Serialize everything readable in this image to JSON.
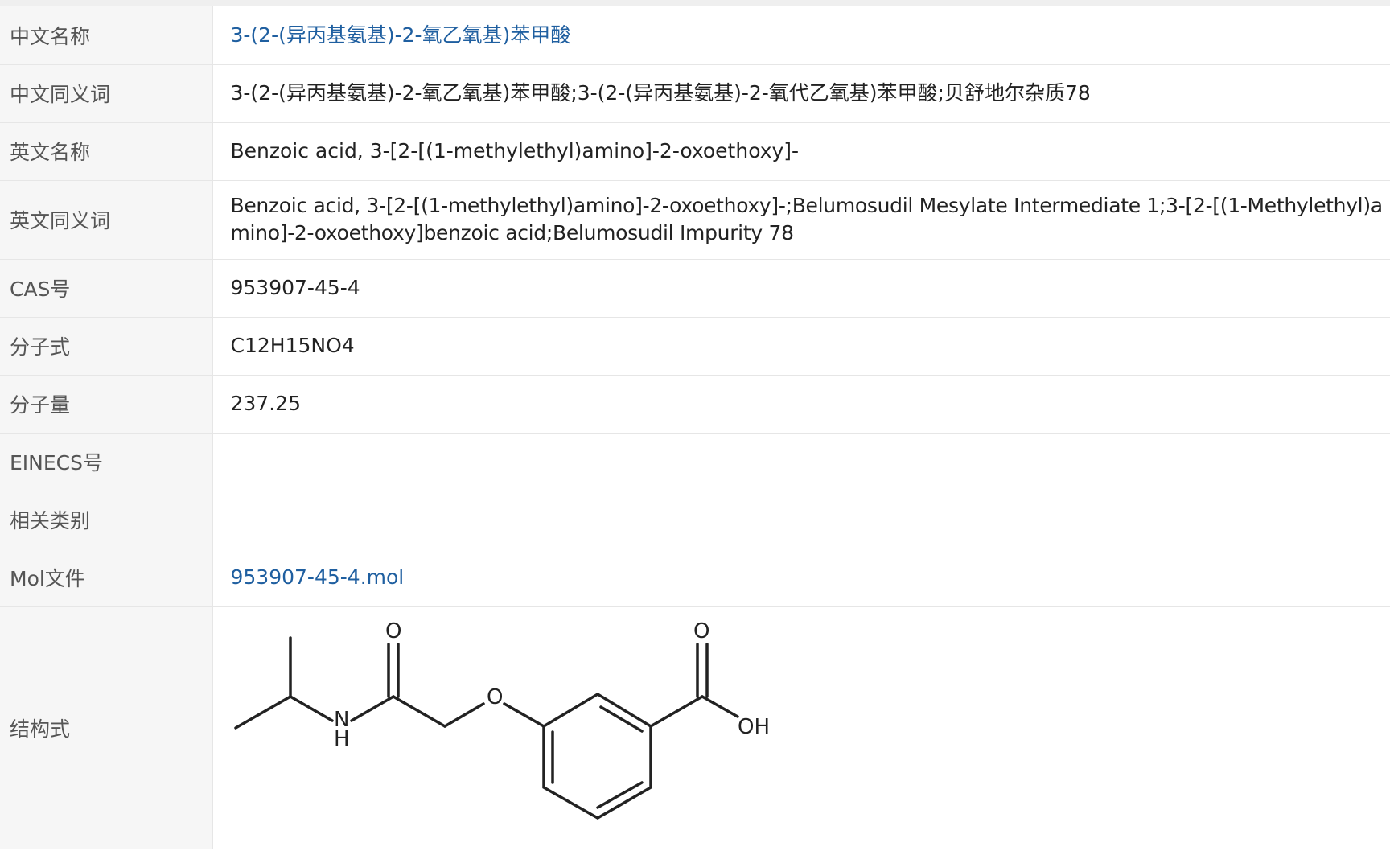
{
  "rows": [
    {
      "label": "中文名称",
      "value": "3-(2-(异丙基氨基)-2-氧乙氧基)苯甲酸"
    },
    {
      "label": "中文同义词",
      "value": "3-(2-(异丙基氨基)-2-氧乙氧基)苯甲酸;3-(2-(异丙基氨基)-2-氧代乙氧基)苯甲酸;贝舒地尔杂质78"
    },
    {
      "label": "英文名称",
      "value": "Benzoic acid, 3-[2-[(1-methylethyl)amino]-2-oxoethoxy]-"
    },
    {
      "label": "英文同义词",
      "value": "Benzoic acid, 3-[2-[(1-methylethyl)amino]-2-oxoethoxy]-;Belumosudil Mesylate Intermediate 1;3-[2-[(1-Methylethyl)amino]-2-oxoethoxy]benzoic acid;Belumosudil Impurity 78"
    },
    {
      "label": "CAS号",
      "value": "953907-45-4"
    },
    {
      "label": "分子式",
      "value": "C12H15NO4"
    },
    {
      "label": "分子量",
      "value": "237.25"
    },
    {
      "label": "EINECS号",
      "value": ""
    },
    {
      "label": "相关类别",
      "value": ""
    },
    {
      "label": "Mol文件",
      "value": "953907-45-4.mol"
    },
    {
      "label": "结构式",
      "value": ""
    }
  ],
  "structure": {
    "atom_labels": {
      "o_amide": "O",
      "nh_n": "N",
      "nh_h": "H",
      "o_ether": "O",
      "o_acid": "O",
      "oh": "OH"
    }
  },
  "colors": {
    "link": "#1f5fa0",
    "label_bg": "#f6f6f6",
    "border": "#e6e6e6"
  }
}
